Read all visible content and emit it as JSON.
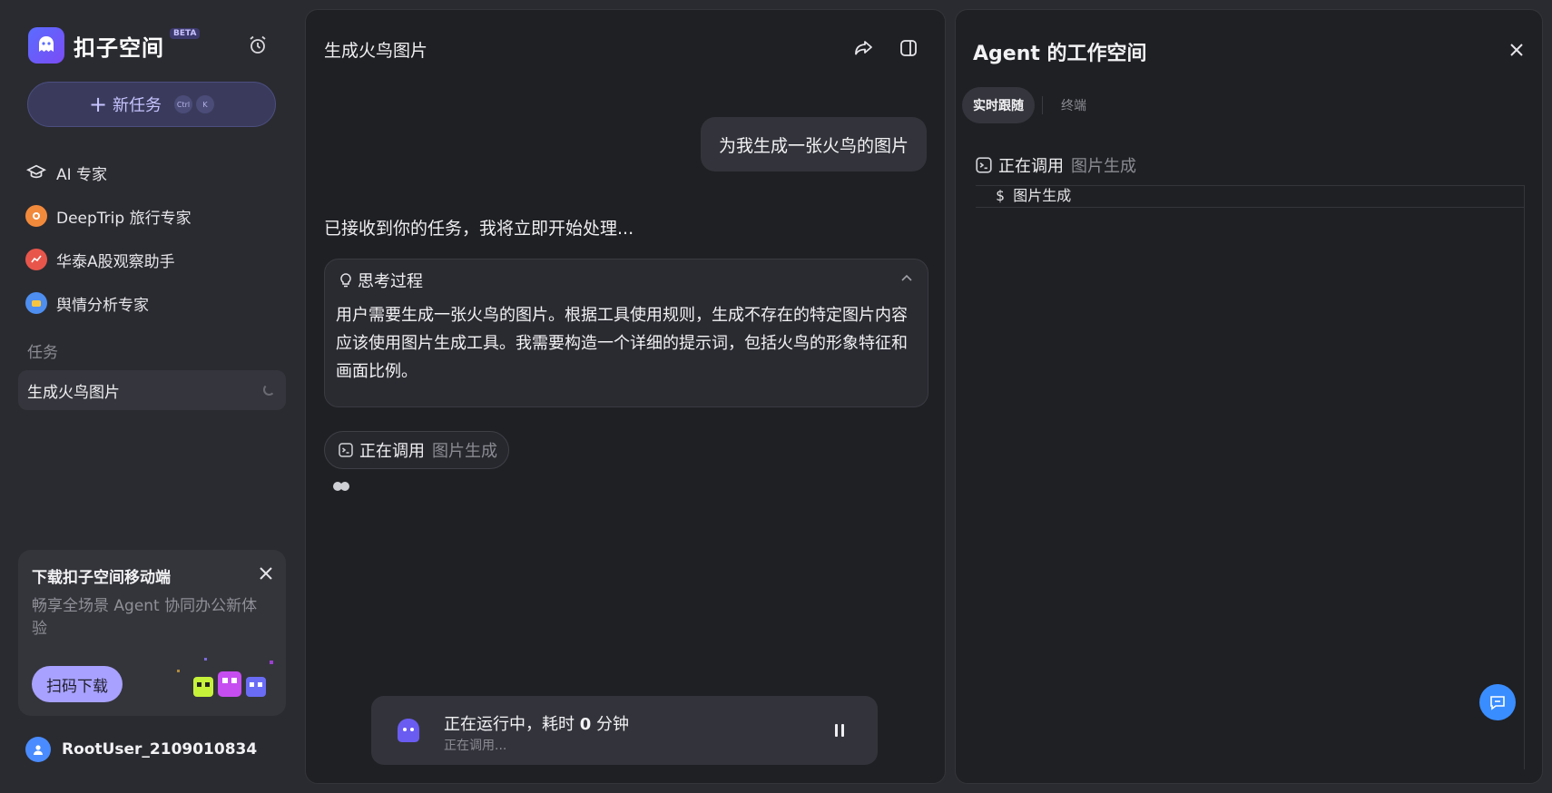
{
  "brand": {
    "name": "扣子空间",
    "badge": "BETA"
  },
  "sidebar": {
    "new_task": {
      "label": "新任务",
      "kbd1": "Ctrl",
      "kbd2": "K"
    },
    "nav": [
      {
        "label": "AI 专家",
        "icon": "graduation-cap-icon"
      },
      {
        "label": "DeepTrip 旅行专家",
        "icon": "deeptrip-avatar-icon"
      },
      {
        "label": "华泰A股观察助手",
        "icon": "huatai-avatar-icon"
      },
      {
        "label": "舆情分析专家",
        "icon": "sentiment-avatar-icon"
      }
    ],
    "section_label": "任务",
    "tasks": [
      {
        "label": "生成火鸟图片",
        "status": "running"
      }
    ],
    "promo": {
      "title": "下载扣子空间移动端",
      "desc": "畅享全场景 Agent 协同办公新体验",
      "button": "扫码下载"
    },
    "user": {
      "name": "RootUser_2109010834"
    }
  },
  "chat": {
    "title": "生成火鸟图片",
    "user_message": "为我生成一张火鸟的图片",
    "ack": "已接收到你的任务，我将立即开始处理...",
    "thinking": {
      "label": "思考过程",
      "body": "用户需要生成一张火鸟的图片。根据工具使用规则，生成不存在的特定图片内容应该使用图片生成工具。我需要构造一个详细的提示词，包括火鸟的形象特征和画面比例。"
    },
    "tool_call": {
      "action": "正在调用",
      "tool": "图片生成"
    },
    "status": {
      "main_prefix": "正在运行中，耗时",
      "main_value": "0",
      "main_suffix": "分钟",
      "sub": "正在调用..."
    }
  },
  "workspace": {
    "title": "Agent 的工作空间",
    "tabs": [
      {
        "label": "实时跟随",
        "active": true
      },
      {
        "label": "终端",
        "active": false
      }
    ],
    "tool_call": {
      "action": "正在调用",
      "tool": "图片生成"
    },
    "terminal_line": "$ 图片生成"
  },
  "colors": {
    "accent": "#a8a1ff",
    "brand": "#5a6cff",
    "feedback": "#3a8dff"
  }
}
